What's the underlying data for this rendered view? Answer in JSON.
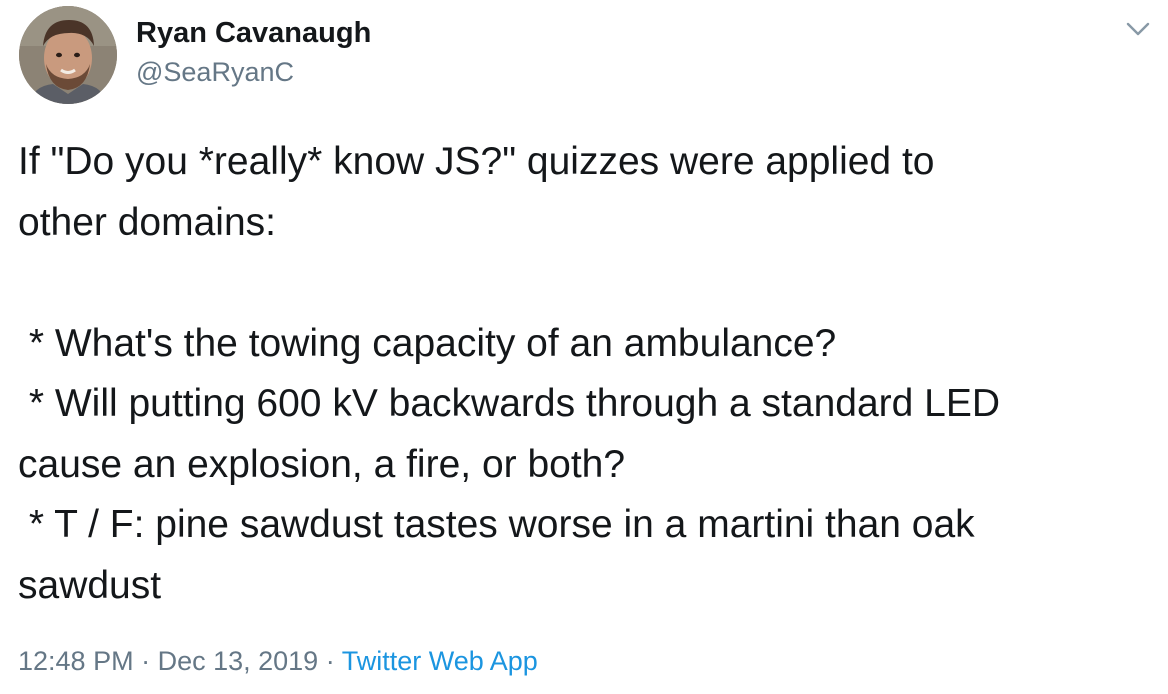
{
  "author": {
    "display_name": "Ryan Cavanaugh",
    "handle": "@SeaRyanC"
  },
  "tweet": {
    "lines": [
      "If \"Do you *really* know JS?\" quizzes were applied to",
      "other domains:",
      "",
      " * What's the towing capacity of an ambulance?",
      " * Will putting 600 kV backwards through a standard LED",
      "cause an explosion, a fire, or both?",
      " * T / F: pine sawdust tastes worse in a martini than oak",
      "sawdust"
    ]
  },
  "meta": {
    "time": "12:48 PM",
    "separator": " · ",
    "date": "Dec 13, 2019",
    "source": "Twitter Web App"
  },
  "icons": {
    "menu": "chevron-down-icon",
    "avatar": "profile-photo"
  },
  "colors": {
    "text": "#14171a",
    "secondary": "#657786",
    "link": "#1b95e0"
  }
}
